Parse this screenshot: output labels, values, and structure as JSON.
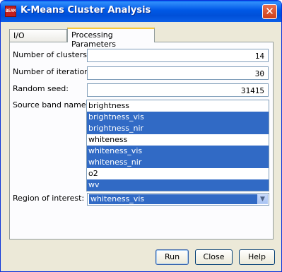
{
  "window": {
    "title": "K-Means Cluster Analysis",
    "icon_text": "BEAM",
    "close_glyph": "✕"
  },
  "tabs": [
    {
      "label": "I/O Parameters",
      "active": false
    },
    {
      "label": "Processing Parameters",
      "active": true
    }
  ],
  "form": {
    "clusters_label": "Number of clusters:",
    "clusters_value": "14",
    "iterations_label": "Number of iterations:",
    "iterations_value": "30",
    "seed_label": "Random seed:",
    "seed_value": "31415",
    "bands_label": "Source band names:",
    "bands": [
      {
        "name": "brightness",
        "selected": false
      },
      {
        "name": "brightness_vis",
        "selected": true
      },
      {
        "name": "brightness_nir",
        "selected": true
      },
      {
        "name": "whiteness",
        "selected": false
      },
      {
        "name": "whiteness_vis",
        "selected": true
      },
      {
        "name": "whiteness_nir",
        "selected": true
      },
      {
        "name": "o2",
        "selected": false
      },
      {
        "name": "wv",
        "selected": true
      }
    ],
    "roi_label": "Region of interest:",
    "roi_value": "whiteness_vis"
  },
  "buttons": {
    "run": "Run",
    "close": "Close",
    "help": "Help"
  },
  "icons": {
    "close": "close-icon",
    "dropdown": "chevron-down-icon",
    "app": "beam-app-icon"
  },
  "colors": {
    "titlebar": "#0058e6",
    "selection": "#316ac5",
    "dialog_bg": "#ece9d8"
  }
}
